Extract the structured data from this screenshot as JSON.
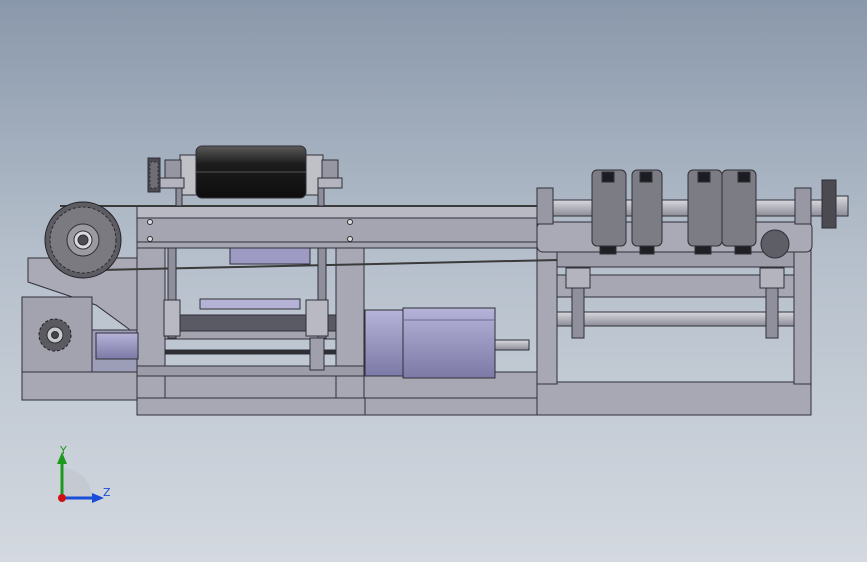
{
  "view": {
    "background_top": "#8a98ab",
    "background_bottom": "#d4d9e0"
  },
  "model": {
    "frame_color": "#a6a6b2",
    "roller_color": "#2a2a2a",
    "motor_color": "#9d9bc4",
    "chain_color": "#3a3a3a"
  },
  "triad": {
    "y_label": "Y",
    "z_label": "Z",
    "y_color": "#1d9a1d",
    "z_color": "#1a4dd8",
    "x_color": "#d01010"
  }
}
